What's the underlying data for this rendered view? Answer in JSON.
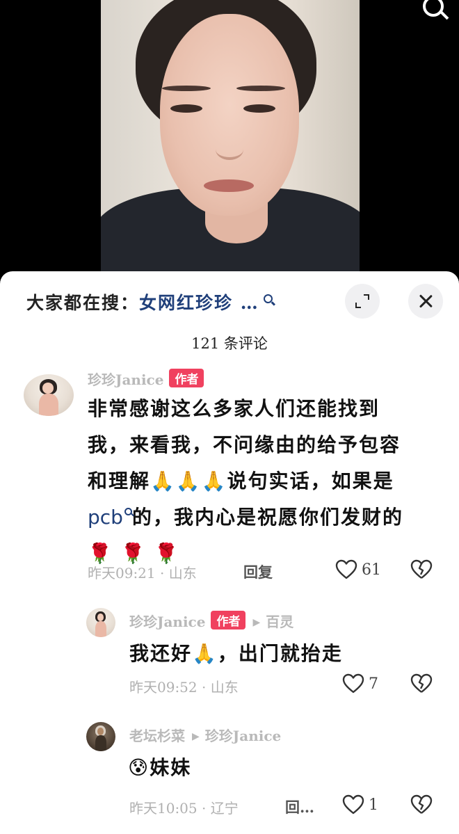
{
  "video": {
    "search_icon": "search-icon"
  },
  "sheet": {
    "suggest_prefix": "大家都在搜：",
    "suggest_term": "女网红珍珍 …",
    "expand_icon": "expand-icon",
    "close_icon": "close-icon",
    "comment_count": "121 条评论"
  },
  "comments": [
    {
      "author": "珍珍Janice",
      "badge": "作者",
      "text_line1": "非常感谢这么多家人们还能找到",
      "text_line2": "我，来看我，不问缘由的给予包容",
      "text_line3a": "和理解",
      "text_line3_emoji": "🙏🙏🙏",
      "text_line3b": "说句实话，如果是",
      "text_line4_link": "pcb",
      "text_line4b": "的，我内心是祝愿你们发财的",
      "text_line5_emoji": "🌹 🌹 🌹",
      "time_location": "昨天09:21 · 山东",
      "reply_label": "回复",
      "likes": "61"
    },
    {
      "author": "珍珍Janice",
      "badge": "作者",
      "reply_to": "百灵",
      "text_a": "我还好",
      "text_emoji": "🙏",
      "text_b": "，出门就抬走",
      "time_location": "昨天09:52 · 山东",
      "likes": "7"
    },
    {
      "author": "老坛杉菜",
      "reply_to": "珍珍Janice",
      "text_emoji": "😰",
      "text": "妹妹",
      "time_location": "昨天10:05 · 辽宁",
      "reply_label": "回…",
      "likes": "1"
    }
  ]
}
